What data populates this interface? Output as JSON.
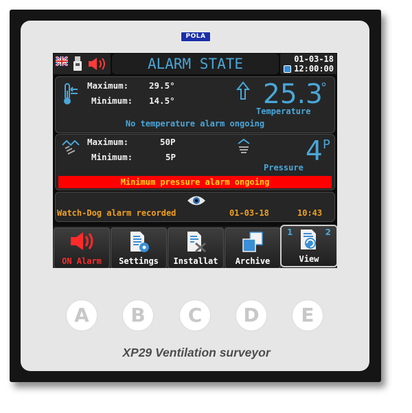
{
  "device": {
    "brand": "POLA",
    "caption": "XP29 Ventilation surveyor"
  },
  "header": {
    "title": "ALARM STATE",
    "date": "01-03-18",
    "time": "12:00:00",
    "icons": [
      "uk-flag-icon",
      "usb-icon",
      "speaker-alarm-icon",
      "clock-icon"
    ]
  },
  "temperature": {
    "max_label": "Maximum:",
    "max_value": "29.5°",
    "min_label": "Minimum:",
    "min_value": "14.5°",
    "value": "25.3",
    "unit": "°",
    "label": "Temperature",
    "status": "No temperature alarm ongoing"
  },
  "pressure": {
    "max_label": "Maximum:",
    "max_value": "50P",
    "min_label": "Minimum:",
    "min_value": "5P",
    "value": "4",
    "unit": "P",
    "label": "Pressure",
    "alarm": "Minimum pressure alarm ongoing"
  },
  "watchdog": {
    "text": "Watch-Dog alarm recorded",
    "date": "01-03-18",
    "time": "10:43"
  },
  "menu": {
    "alarm": "ON Alarm",
    "settings": "Settings",
    "installation": "Installat",
    "archive": "Archive",
    "view": "View",
    "view_num1": "1",
    "view_num2": "2"
  },
  "hardware_buttons": [
    "A",
    "B",
    "C",
    "D",
    "E"
  ],
  "colors": {
    "accent_blue": "#4aa6d8",
    "alarm_red": "#ff0000",
    "alarm_text_yellow": "#ffd11a",
    "watchdog_orange": "#f0a020"
  }
}
